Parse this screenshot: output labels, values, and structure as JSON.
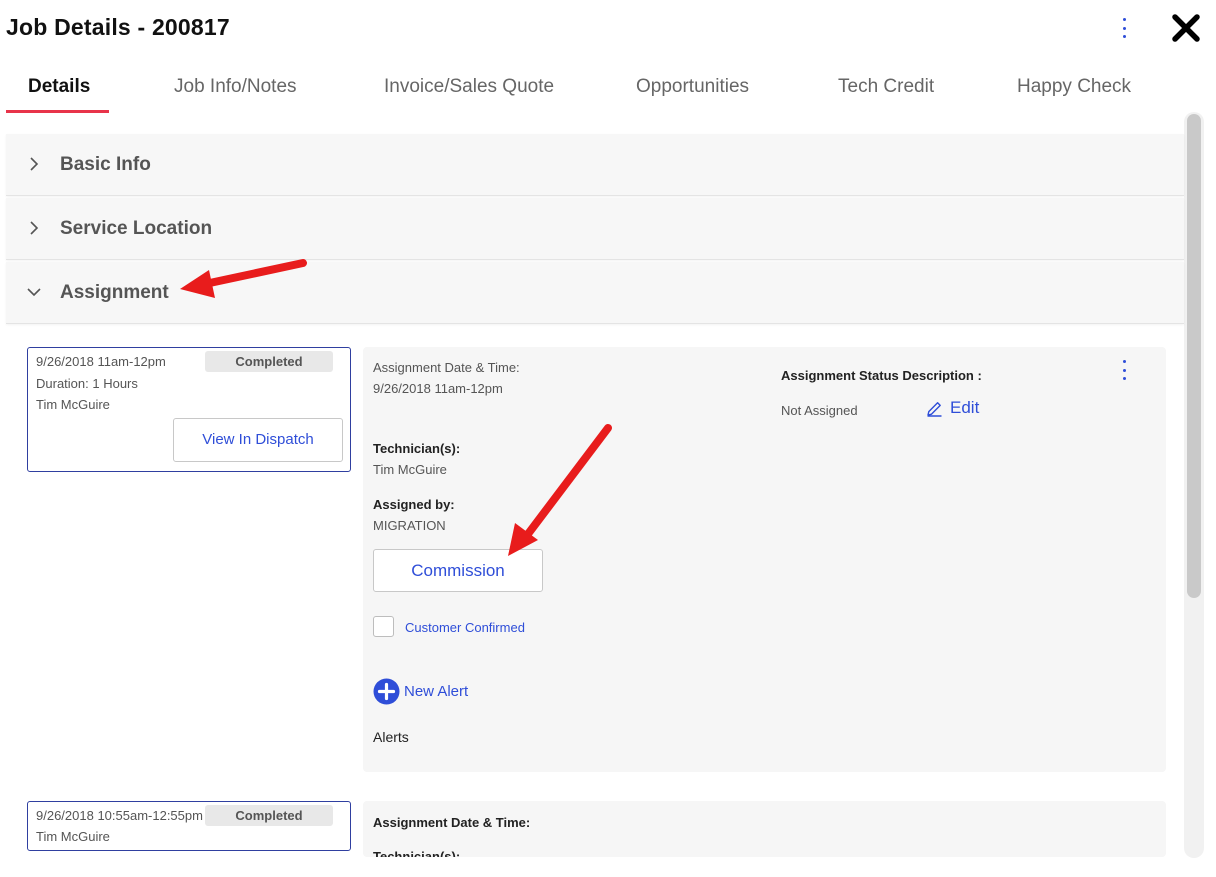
{
  "header": {
    "title": "Job Details - 200817"
  },
  "tabs": [
    {
      "label": "Details",
      "active": true
    },
    {
      "label": "Job Info/Notes",
      "active": false
    },
    {
      "label": "Invoice/Sales Quote",
      "active": false
    },
    {
      "label": "Opportunities",
      "active": false
    },
    {
      "label": "Tech Credit",
      "active": false
    },
    {
      "label": "Happy Check",
      "active": false
    }
  ],
  "sections": {
    "basic_info": {
      "label": "Basic Info",
      "expanded": false
    },
    "service_location": {
      "label": "Service Location",
      "expanded": false
    },
    "assignment": {
      "label": "Assignment",
      "expanded": true
    }
  },
  "assignments": [
    {
      "card": {
        "time_range": "9/26/2018 11am-12pm",
        "status": "Completed",
        "duration": "Duration: 1 Hours",
        "technician": "Tim McGuire",
        "view_button": "View In Dispatch"
      },
      "detail": {
        "date_label": "Assignment Date & Time:",
        "date_value": "9/26/2018 11am-12pm",
        "technicians_label": "Technician(s):",
        "technicians_value": "Tim McGuire",
        "assigned_by_label": "Assigned by:",
        "assigned_by_value": "MIGRATION",
        "commission_button": "Commission",
        "customer_confirmed_label": "Customer Confirmed",
        "customer_confirmed_checked": false,
        "new_alert_label": "New Alert",
        "alerts_label": "Alerts",
        "status_desc_label": "Assignment Status Description :",
        "status_desc_value": "Not Assigned",
        "edit_label": "Edit"
      }
    },
    {
      "card": {
        "time_range": "9/26/2018 10:55am-12:55pm",
        "status": "Completed",
        "technician": "Tim McGuire"
      },
      "detail": {
        "date_label": "Assignment Date & Time:",
        "technicians_label": "Technician(s):"
      }
    }
  ],
  "colors": {
    "accent": "#2f4ed8",
    "active_tab_underline": "#e8344a",
    "annotation_arrow": "#e81c1c",
    "card_border": "#2f3fa0"
  }
}
